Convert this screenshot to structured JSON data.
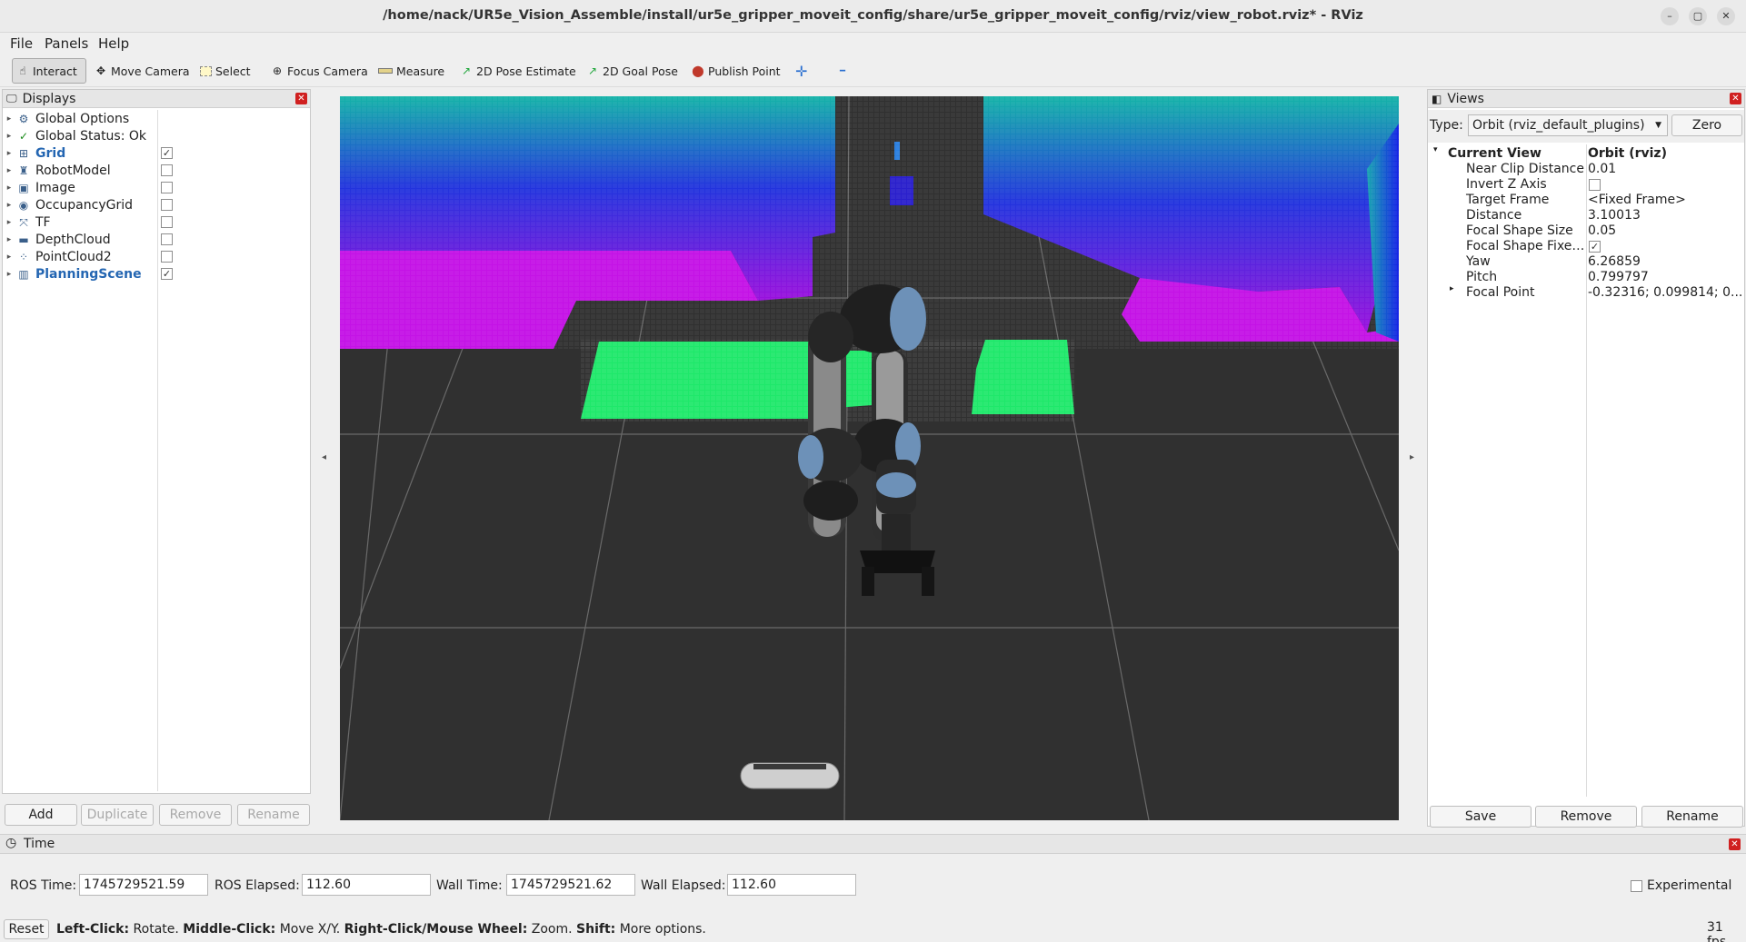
{
  "window": {
    "title": "/home/nack/UR5e_Vision_Assemble/install/ur5e_gripper_moveit_config/share/ur5e_gripper_moveit_config/rviz/view_robot.rviz* - RViz",
    "minimize": "–",
    "maximize": "▢",
    "close": "✕"
  },
  "menu": {
    "file": "File",
    "panels": "Panels",
    "help": "Help"
  },
  "toolbar": {
    "interact": "Interact",
    "move_camera": "Move Camera",
    "select": "Select",
    "focus_camera": "Focus Camera",
    "measure": "Measure",
    "pose_estimate": "2D Pose Estimate",
    "goal_pose": "2D Goal Pose",
    "publish_point": "Publish Point",
    "plus": "✛",
    "minus": "━"
  },
  "displays": {
    "title": "Displays",
    "items": [
      {
        "label": "Global Options",
        "icon": "⚙",
        "checkbox": null,
        "highlight": false
      },
      {
        "label": "Global Status: Ok",
        "icon": "✓",
        "checkbox": null,
        "highlight": false
      },
      {
        "label": "Grid",
        "icon": "⊞",
        "checkbox": "✓",
        "highlight": true
      },
      {
        "label": "RobotModel",
        "icon": "♜",
        "checkbox": "",
        "highlight": false
      },
      {
        "label": "Image",
        "icon": "▣",
        "checkbox": "",
        "highlight": false
      },
      {
        "label": "OccupancyGrid",
        "icon": "◉",
        "checkbox": "",
        "highlight": false
      },
      {
        "label": "TF",
        "icon": "⤧",
        "checkbox": "",
        "highlight": false
      },
      {
        "label": "DepthCloud",
        "icon": "▬",
        "checkbox": "",
        "highlight": false
      },
      {
        "label": "PointCloud2",
        "icon": "⁘",
        "checkbox": "",
        "highlight": false
      },
      {
        "label": "PlanningScene",
        "icon": "▥",
        "checkbox": "✓",
        "highlight": true
      }
    ],
    "buttons": {
      "add": "Add",
      "duplicate": "Duplicate",
      "remove": "Remove",
      "rename": "Rename"
    }
  },
  "views": {
    "title": "Views",
    "type_label": "Type:",
    "type_value": "Orbit (rviz_default_plugins)",
    "zero": "Zero",
    "current_view": "Current View",
    "current_view_value": "Orbit (rviz)",
    "props": [
      {
        "name": "Near Clip Distance",
        "value": "0.01",
        "checkbox": false
      },
      {
        "name": "Invert Z Axis",
        "value": "",
        "checkbox": true,
        "checked": ""
      },
      {
        "name": "Target Frame",
        "value": "<Fixed Frame>",
        "checkbox": false
      },
      {
        "name": "Distance",
        "value": "3.10013",
        "checkbox": false
      },
      {
        "name": "Focal Shape Size",
        "value": "0.05",
        "checkbox": false
      },
      {
        "name": "Focal Shape Fixe…",
        "value": "",
        "checkbox": true,
        "checked": "✓"
      },
      {
        "name": "Yaw",
        "value": "6.26859",
        "checkbox": false
      },
      {
        "name": "Pitch",
        "value": "0.799797",
        "checkbox": false
      },
      {
        "name": "Focal Point",
        "value": "-0.32316; 0.099814; 0....",
        "checkbox": false
      }
    ],
    "buttons": {
      "save": "Save",
      "remove": "Remove",
      "rename": "Rename"
    }
  },
  "time": {
    "title": "Time",
    "ros_time_label": "ROS Time:",
    "ros_time": "1745729521.59",
    "ros_elapsed_label": "ROS Elapsed:",
    "ros_elapsed": "112.60",
    "wall_time_label": "Wall Time:",
    "wall_time": "1745729521.62",
    "wall_elapsed_label": "Wall Elapsed:",
    "wall_elapsed": "112.60",
    "experimental": "Experimental"
  },
  "status": {
    "reset": "Reset",
    "left_click": "Left-Click:",
    "left_click_desc": " Rotate. ",
    "middle_click": "Middle-Click:",
    "middle_click_desc": " Move X/Y. ",
    "right_click": "Right-Click/Mouse Wheel:",
    "right_click_desc": " Zoom. ",
    "shift": "Shift:",
    "shift_desc": " More options.",
    "fps": "31 fps"
  },
  "colors": {
    "grid_bg": "#303030",
    "occupancy_green": "#22ee66",
    "pointcloud_magenta": "#cc11ee",
    "pointcloud_teal": "#11aaaa",
    "pointcloud_blue": "#2211dd",
    "link_blue": "#2466b2"
  }
}
